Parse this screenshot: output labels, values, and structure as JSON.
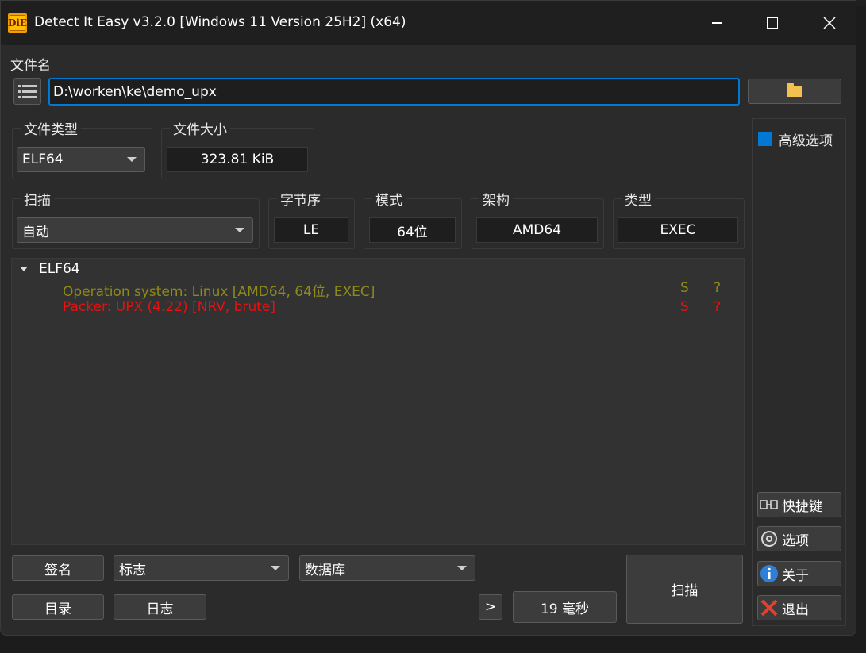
{
  "window": {
    "title": "Detect It Easy v3.2.0 [Windows 11 Version 25H2] (x64)",
    "icon_label": "DiE"
  },
  "file": {
    "label": "文件名",
    "path": "D:\\worken\\ke\\demo_upx"
  },
  "file_type": {
    "label": "文件类型",
    "value": "ELF64"
  },
  "file_size": {
    "label": "文件大小",
    "value": "323.81 KiB"
  },
  "scan": {
    "label": "扫描",
    "mode": "自动"
  },
  "info": {
    "endian_label": "字节序",
    "endian": "LE",
    "mode_label": "模式",
    "mode": "64位",
    "arch_label": "架构",
    "arch": "AMD64",
    "type_label": "类型",
    "type": "EXEC"
  },
  "results": {
    "root": "ELF64",
    "rows": [
      {
        "text": "Operation system: Linux [AMD64, 64位, EXEC]",
        "flag1": "S",
        "flag2": "?",
        "color": "#8e8a1a"
      },
      {
        "text": "Packer: UPX (4.22) [NRV, brute]",
        "flag1": "S",
        "flag2": "?",
        "color": "#e81010"
      }
    ]
  },
  "advanced": {
    "label": "高级选项",
    "checked": true
  },
  "side_buttons": {
    "shortcuts": "快捷键",
    "options": "选项",
    "about": "关于",
    "exit": "退出"
  },
  "bottom": {
    "signature": "签名",
    "flags": "标志",
    "database": "数据库",
    "directory": "目录",
    "log": "日志",
    "more": ">",
    "elapsed": "19 毫秒",
    "scan": "扫描"
  },
  "colors": {
    "accent": "#0078d4",
    "background": "#2b2b2b",
    "result_os": "#8e8a1a",
    "result_packer": "#e81010"
  }
}
